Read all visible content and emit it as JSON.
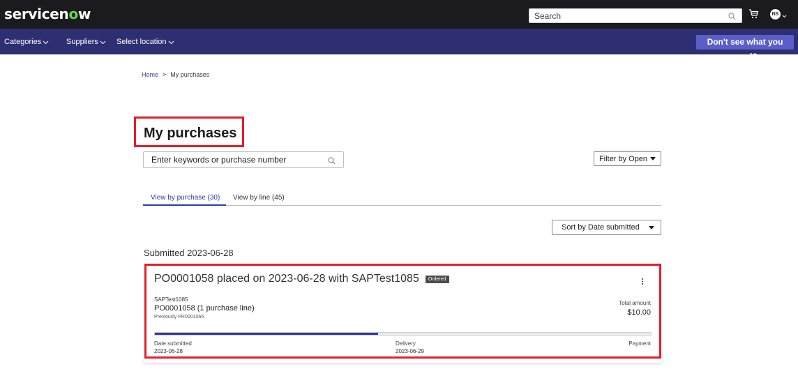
{
  "topbar": {
    "logo_prefix": "servicen",
    "logo_o": "o",
    "logo_suffix": "w",
    "search_placeholder": "Search",
    "avatar_initials": "NS",
    "bg_color": "#1b1b1f"
  },
  "nav": {
    "items": [
      {
        "label": "Categories"
      },
      {
        "label": "Suppliers"
      },
      {
        "label": "Select location"
      }
    ],
    "help_button": "Don't see what you need?",
    "bg_color": "#2e2f72"
  },
  "breadcrumb": {
    "home": "Home",
    "separator": ">",
    "current": "My purchases"
  },
  "page": {
    "title": "My purchases",
    "keyword_placeholder": "Enter keywords or purchase number",
    "filter_label": "Filter by Open",
    "tabs": [
      {
        "label": "View by purchase (30)",
        "active": true
      },
      {
        "label": "View by line (45)",
        "active": false
      }
    ],
    "sort_label": "Sort by Date submitted",
    "group_heading": "Submitted 2023-06-28"
  },
  "purchase": {
    "title": "PO0001058 placed on 2023-06-28 with SAPTest1085",
    "status": "Ordered",
    "supplier": "SAPTest1085",
    "po_line": "PO0001058 (1 purchase line)",
    "previously": "Previously PR0001066",
    "total_label": "Total amount",
    "total_value": "$10.00",
    "progress_fraction": 0.45,
    "steps": [
      {
        "label": "Date submitted",
        "date": "2023-06-28"
      },
      {
        "label": "Delivery",
        "date": "2023-06-29"
      },
      {
        "label": "Payment",
        "date": ""
      }
    ]
  },
  "colors": {
    "accent": "#2e3aa8",
    "highlight_border": "#e41e2a",
    "logo_green": "#62d84e"
  }
}
